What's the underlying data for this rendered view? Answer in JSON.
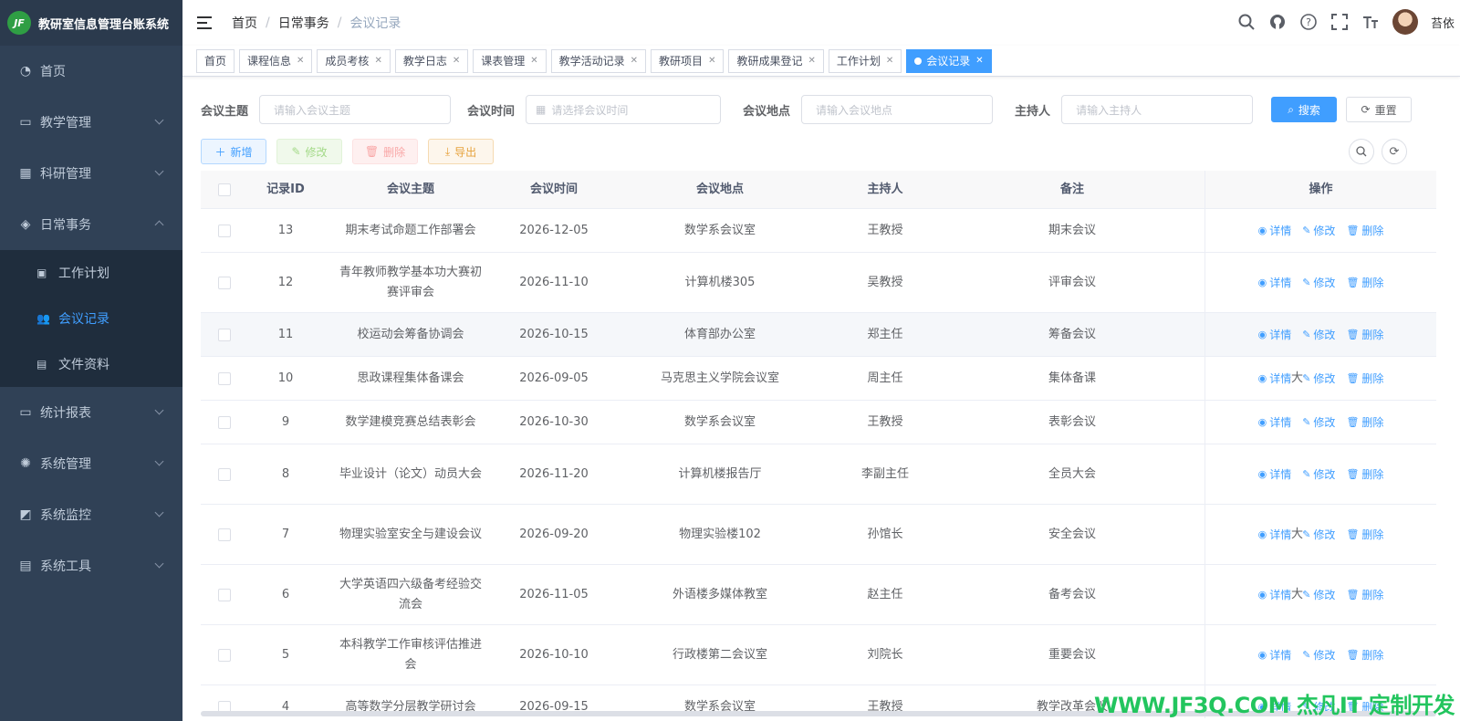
{
  "app": {
    "logo_text": "JF",
    "title": "教研室信息管理台账系统"
  },
  "sidebar": {
    "items": [
      {
        "label": "首页",
        "icon": "dashboard-icon"
      },
      {
        "label": "教学管理",
        "icon": "book-icon"
      },
      {
        "label": "科研管理",
        "icon": "grid-icon"
      },
      {
        "label": "日常事务",
        "icon": "layers-icon",
        "expanded": true
      },
      {
        "label": "统计报表",
        "icon": "monitor-icon"
      },
      {
        "label": "系统管理",
        "icon": "gear-icon"
      },
      {
        "label": "系统监控",
        "icon": "chart-monitor-icon"
      },
      {
        "label": "系统工具",
        "icon": "toolbox-icon"
      }
    ],
    "sub_items": [
      {
        "label": "工作计划",
        "icon": "image-icon"
      },
      {
        "label": "会议记录",
        "icon": "people-icon",
        "active": true
      },
      {
        "label": "文件资料",
        "icon": "doc-icon"
      }
    ]
  },
  "breadcrumb": [
    "首页",
    "日常事务",
    "会议记录"
  ],
  "user": {
    "name": "苔依"
  },
  "tags": [
    "首页",
    "课程信息",
    "成员考核",
    "教学日志",
    "课表管理",
    "教学活动记录",
    "教研项目",
    "教研成果登记",
    "工作计划",
    "会议记录"
  ],
  "search": {
    "fields": [
      {
        "label": "会议主题",
        "placeholder": "请输入会议主题"
      },
      {
        "label": "会议时间",
        "placeholder": "请选择会议时间"
      },
      {
        "label": "会议地点",
        "placeholder": "请输入会议地点"
      },
      {
        "label": "主持人",
        "placeholder": "请输入主持人"
      }
    ],
    "search_label": "搜索",
    "reset_label": "重置"
  },
  "toolbar": {
    "add": "新增",
    "edit": "修改",
    "delete": "删除",
    "export": "导出"
  },
  "table": {
    "headers": [
      "记录ID",
      "会议主题",
      "会议时间",
      "会议地点",
      "主持人",
      "备注",
      "操作"
    ],
    "ops": [
      "详情",
      "修改",
      "删除"
    ],
    "rows": [
      {
        "id": "13",
        "topic": "期末考试命题工作部署会",
        "time": "2026-12-05",
        "place": "数学系会议室",
        "host": "王教授",
        "note": "期末会议",
        "extra": ""
      },
      {
        "id": "12",
        "topic": "青年教师教学基本功大赛初赛评审会",
        "time": "2026-11-10",
        "place": "计算机楼305",
        "host": "吴教授",
        "note": "评审会议",
        "extra": ""
      },
      {
        "id": "11",
        "topic": "校运动会筹备协调会",
        "time": "2026-10-15",
        "place": "体育部办公室",
        "host": "郑主任",
        "note": "筹备会议",
        "extra": ""
      },
      {
        "id": "10",
        "topic": "思政课程集体备课会",
        "time": "2026-09-05",
        "place": "马克思主义学院会议室",
        "host": "周主任",
        "note": "集体备课",
        "extra": "大"
      },
      {
        "id": "9",
        "topic": "数学建模竞赛总结表彰会",
        "time": "2026-10-30",
        "place": "数学系会议室",
        "host": "王教授",
        "note": "表彰会议",
        "extra": ""
      },
      {
        "id": "8",
        "topic": "毕业设计（论文）动员大会",
        "time": "2026-11-20",
        "place": "计算机楼报告厅",
        "host": "李副主任",
        "note": "全员大会",
        "extra": ""
      },
      {
        "id": "7",
        "topic": "物理实验室安全与建设会议",
        "time": "2026-09-20",
        "place": "物理实验楼102",
        "host": "孙馆长",
        "note": "安全会议",
        "extra": "大"
      },
      {
        "id": "6",
        "topic": "大学英语四六级备考经验交流会",
        "time": "2026-11-05",
        "place": "外语楼多媒体教室",
        "host": "赵主任",
        "note": "备考会议",
        "extra": "大"
      },
      {
        "id": "5",
        "topic": "本科教学工作审核评估推进会",
        "time": "2026-10-10",
        "place": "行政楼第二会议室",
        "host": "刘院长",
        "note": "重要会议",
        "extra": ""
      },
      {
        "id": "4",
        "topic": "高等数学分层教学研讨会",
        "time": "2026-09-15",
        "place": "数学系会议室",
        "host": "王教授",
        "note": "教学改革会议",
        "extra": ""
      }
    ]
  },
  "watermark": "WWW.JF3Q.COM 杰凡IT 定制开发",
  "colors": {
    "sidebar": "#304156",
    "accent": "#409eff",
    "watermark": "#22c55e"
  }
}
